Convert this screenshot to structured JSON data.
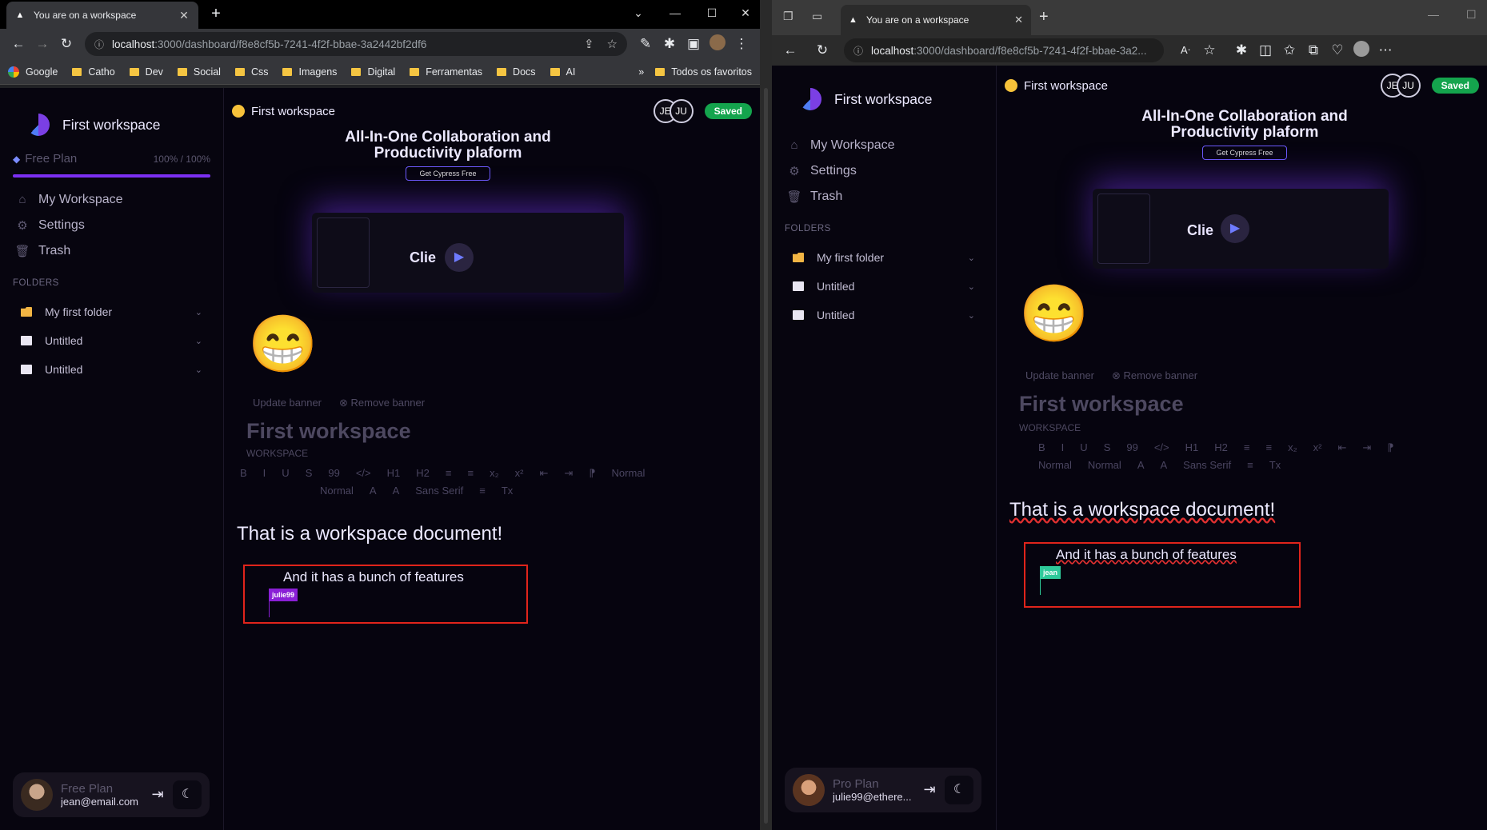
{
  "left": {
    "tab_title": "You are on a workspace",
    "url_host": "localhost",
    "url_path": ":3000/dashboard/f8e8cf5b-7241-4f2f-bbae-3a2442bf2df6",
    "bookmarks": [
      "Google",
      "Catho",
      "Dev",
      "Social",
      "Css",
      "Imagens",
      "Digital",
      "Ferramentas",
      "Docs",
      "AI"
    ],
    "bookmarks_more": "»",
    "bookmarks_all": "Todos os favoritos",
    "workspace_name": "First workspace",
    "plan_label": "Free Plan",
    "plan_usage": "100% / 100%",
    "nav": [
      "My Workspace",
      "Settings",
      "Trash"
    ],
    "folders_label": "FOLDERS",
    "folders": [
      "My first folder",
      "Untitled",
      "Untitled"
    ],
    "crumb": "First workspace",
    "avatars": [
      "JE",
      "JU"
    ],
    "saved": "Saved",
    "banner_title_1": "All-In-One Collaboration and",
    "banner_title_2": "Productivity plaform",
    "banner_cta": "Get Cypress Free",
    "preview_text": "Clie",
    "update_banner": "Update banner",
    "remove_banner": "Remove banner",
    "doc_title": "First workspace",
    "doc_sub": "WORKSPACE",
    "toolbar_row1": [
      "B",
      "I",
      "U",
      "S",
      "99",
      "</>",
      "H1",
      "H2",
      "≡",
      "≡",
      "x₂",
      "x²",
      "⇤",
      "⇥",
      "⁋",
      "Normal"
    ],
    "toolbar_row2": [
      "Normal",
      "A",
      "A",
      "Sans Serif",
      "≡",
      "Tx"
    ],
    "heading": "That is a workspace document!",
    "line2": "And it has a bunch of features",
    "cursor_user": "julie99",
    "user_plan": "Free Plan",
    "user_email": "jean@email.com"
  },
  "right": {
    "tab_title": "You are on a workspace",
    "url_host": "localhost",
    "url_path": ":3000/dashboard/f8e8cf5b-7241-4f2f-bbae-3a2...",
    "workspace_name": "First workspace",
    "nav": [
      "My Workspace",
      "Settings",
      "Trash"
    ],
    "folders_label": "FOLDERS",
    "folders": [
      "My first folder",
      "Untitled",
      "Untitled"
    ],
    "crumb": "First workspace",
    "avatars": [
      "JE",
      "JU"
    ],
    "saved": "Saved",
    "banner_title_1": "All-In-One Collaboration and",
    "banner_title_2": "Productivity plaform",
    "banner_cta": "Get Cypress Free",
    "preview_text": "Clie",
    "update_banner": "Update banner",
    "remove_banner": "Remove banner",
    "doc_title": "First workspace",
    "doc_sub": "WORKSPACE",
    "toolbar_row1": [
      "B",
      "I",
      "U",
      "S",
      "99",
      "</>",
      "H1",
      "H2",
      "≡",
      "≡",
      "x₂",
      "x²",
      "⇤",
      "⇥",
      "⁋"
    ],
    "toolbar_row2": [
      "Normal",
      "Normal",
      "A",
      "A",
      "Sans Serif",
      "≡",
      "Tx"
    ],
    "heading": "That is a workspace document!",
    "line2": "And it has a bunch of features",
    "cursor_user": "jean",
    "user_plan": "Pro Plan",
    "user_email": "julie99@ethere..."
  },
  "colors": {
    "accent": "#7b2ff2",
    "saved": "#14a44d",
    "redbox": "#e0241b",
    "cursor_left": "#8a1fd6",
    "cursor_right": "#2ec99a"
  }
}
